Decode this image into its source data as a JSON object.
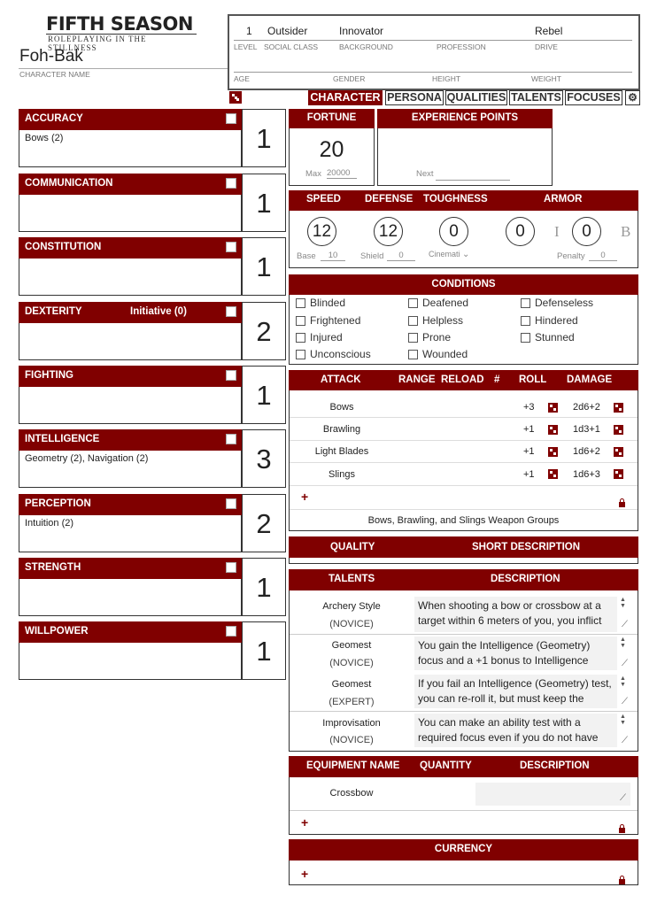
{
  "logo": {
    "title": "FIFTH SEASON",
    "subtitle": "ROLEPLAYING IN THE STILLNESS"
  },
  "character": {
    "name": "Foh-Bak",
    "name_label": "CHARACTER NAME"
  },
  "info": {
    "level": "1",
    "social_class": "Outsider",
    "background": "Innovator",
    "profession": "",
    "drive": "Rebel",
    "labels": {
      "level": "LEVEL",
      "social_class": "SOCIAL CLASS",
      "background": "BACKGROUND",
      "profession": "PROFESSION",
      "drive": "DRIVE",
      "age": "AGE",
      "gender": "GENDER",
      "height": "HEIGHT",
      "weight": "WEIGHT"
    }
  },
  "tabs": [
    "CHARACTER",
    "PERSONA",
    "QUALITIES",
    "TALENTS",
    "FOCUSES"
  ],
  "abilities": [
    {
      "name": "ACCURACY",
      "extra": "",
      "focus": "Bows (2)",
      "value": "1"
    },
    {
      "name": "COMMUNICATION",
      "extra": "",
      "focus": "",
      "value": "1"
    },
    {
      "name": "CONSTITUTION",
      "extra": "",
      "focus": "",
      "value": "1"
    },
    {
      "name": "DEXTERITY",
      "extra": "Initiative (0)",
      "focus": "",
      "value": "2"
    },
    {
      "name": "FIGHTING",
      "extra": "",
      "focus": "",
      "value": "1"
    },
    {
      "name": "INTELLIGENCE",
      "extra": "",
      "focus": "Geometry (2),  Navigation (2)",
      "value": "3"
    },
    {
      "name": "PERCEPTION",
      "extra": "",
      "focus": "Intuition (2)",
      "value": "2"
    },
    {
      "name": "STRENGTH",
      "extra": "",
      "focus": "",
      "value": "1"
    },
    {
      "name": "WILLPOWER",
      "extra": "",
      "focus": "",
      "value": "1"
    }
  ],
  "fortune": {
    "label": "FORTUNE",
    "value": "20",
    "max_label": "Max",
    "max": "20000"
  },
  "xp": {
    "label": "EXPERIENCE POINTS",
    "next_label": "Next"
  },
  "stats": {
    "speed_label": "SPEED",
    "defense_label": "DEFENSE",
    "toughness_label": "TOUGHNESS",
    "armor_label": "ARMOR",
    "speed": "12",
    "defense": "12",
    "toughness": "0",
    "armor_i": "0",
    "armor_b": "0",
    "base_label": "Base",
    "base": "10",
    "shield_label": "Shield",
    "shield": "0",
    "cinematic_label": "Cinemati",
    "penalty_label": "Penalty",
    "penalty": "0",
    "i_letter": "I",
    "b_letter": "B"
  },
  "conditions": {
    "label": "CONDITIONS",
    "items": [
      "Blinded",
      "Deafened",
      "Defenseless",
      "Frightened",
      "Helpless",
      "Hindered",
      "Injured",
      "Prone",
      "Stunned",
      "Unconscious",
      "Wounded"
    ]
  },
  "attacks": {
    "headers": {
      "attack": "ATTACK",
      "range": "RANGE",
      "reload": "RELOAD",
      "num": "#",
      "roll": "ROLL",
      "damage": "DAMAGE"
    },
    "rows": [
      {
        "name": "Bows",
        "roll": "+3",
        "damage": "2d6+2"
      },
      {
        "name": "Brawling",
        "roll": "+1",
        "damage": "1d3+1"
      },
      {
        "name": "Light Blades",
        "roll": "+1",
        "damage": "1d6+2"
      },
      {
        "name": "Slings",
        "roll": "+1",
        "damage": "1d6+3"
      }
    ],
    "add": "+",
    "groups": "Bows, Brawling, and Slings Weapon Groups"
  },
  "quality": {
    "label": "QUALITY",
    "desc_label": "SHORT DESCRIPTION"
  },
  "talents": {
    "label": "TALENTS",
    "desc_label": "DESCRIPTION",
    "rows": [
      {
        "name": "Archery Style",
        "rank": "(NOVICE)",
        "desc": "When shooting a bow or crossbow at a target within 6 meters of you, you inflict"
      },
      {
        "name": "Geomest",
        "rank": "(NOVICE)",
        "desc": "You gain the Intelligence (Geometry) focus and a +1 bonus to Intelligence"
      },
      {
        "name": "Geomest",
        "rank": "(EXPERT)",
        "desc": "If you fail an Intelligence (Geometry) test, you can re-roll it, but must keep the"
      },
      {
        "name": "Improvisation",
        "rank": "(NOVICE)",
        "desc": "You can make an ability test with a required focus even if you do not have"
      }
    ]
  },
  "equipment": {
    "name_label": "EQUIPMENT NAME",
    "qty_label": "QUANTITY",
    "desc_label": "DESCRIPTION",
    "rows": [
      {
        "name": "Crossbow"
      }
    ],
    "add": "+"
  },
  "currency": {
    "label": "CURRENCY",
    "add": "+"
  },
  "colors": {
    "accent": "#800000"
  }
}
